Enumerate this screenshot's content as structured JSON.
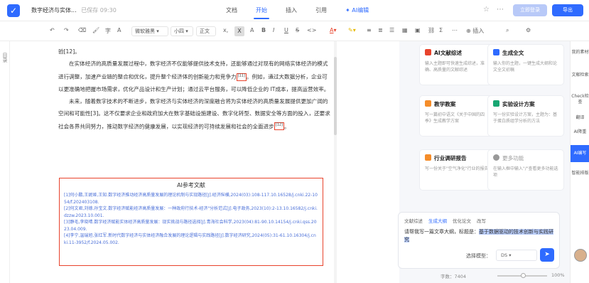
{
  "app": {
    "doc_title": "数字经济与实体...",
    "saved_status": "已保存 09:30"
  },
  "tabs": [
    {
      "label": "文档"
    },
    {
      "label": "开始"
    },
    {
      "label": "插入"
    },
    {
      "label": "引用"
    },
    {
      "label": "AI编辑"
    }
  ],
  "header_buttons": {
    "login": "立即登录",
    "export": "导出"
  },
  "toolbar": {
    "font_family": "微软雅黑",
    "font_size": "小四",
    "paragraph_style": "正文",
    "insert": "插入"
  },
  "gutter": {
    "label": "目录"
  },
  "document": {
    "p0": "验[12]。",
    "p1_a": "在实体经济的高质量发展过程中，数字经济不仅能够提供技术支持，还能够通过对现有的网络实体经济的模式进行调整，加速产业链的整合和优化，提升整个经济体的创新能力和竞争力",
    "p1_cite": "[11]",
    "p1_b": "。例如，通过大数据分析，企业可以更准确地把握市场需求，优化产品设计和生产计划；通过云平台服务，可以降低企业的 IT成本，提高运营效率。",
    "p2_a": "未来，随着数字技术的不断进步，数字经济与实体经济的深度融合将为实体经济的高质量发展提供更加广阔的空间和可能性[3]。这不仅要求企业和政府加大在数字基础设施建设、数字化转型、数据安全等方面的投入，还要求社会各界共同努力，推动数字经济的健康发展，以实现经济的可持续发展和社会的全面进步",
    "p2_cite": "[12]",
    "p2_b": "。"
  },
  "references": {
    "title": "AI参考文献",
    "items": [
      "[1]何小鹏,王妮娅,王知.数字经济推动经济高质量发展的理论机制与实现路径[J].经济纵横,2024(03):108-117.10.16528/j.cnki.22-1054/f.202403108.",
      "[2]何文君,刘德,孙宝文.数字经济赋能经济高质量发展：一种政府行技术-经济\"分析范式[J].电子政务,2023(10):2-13.10.16582/j.cnki.dzzw.2023.10.001.",
      "[3]静毛,李晓晴.数字经济赋能实体经济高质量发展：现实挑战与路径选择[J].青海社会科学,2023(04):81-90.10.14154/j.cnki.qss.2023.04.009.",
      "[4]李宁,温瑞旭,张红军.新时代数字经济与实体经济融合发展的理论逻辑与实践路径[J].数字经济研究,2024(05):31-61.10.16304/j.cnki.11-3952/f.2024.05.002."
    ]
  },
  "ai_panel": {
    "cards": [
      {
        "title": "AI文献综述",
        "desc": "输入主题即可快速生成综述，准确、高质量的文献综述",
        "color": "#e8432c"
      },
      {
        "title": "生成全文",
        "desc": "输入你的主题，一键生成大纲和论文全文初稿",
        "color": "#2f6bff"
      },
      {
        "title": "教学教案",
        "desc": "写一篇初中语文《关于中国的四季》生成教学方案",
        "color": "#f58d2a"
      },
      {
        "title": "实验设计方案",
        "desc": "写一份实验设计方案，主题为：基于蛋白质组学分析的方法",
        "color": "#19a773"
      },
      {
        "title": "行业调研报告",
        "desc": "写一份关于\"空气净化\"行业的报告",
        "color": "#f58d2a"
      },
      {
        "title": "更多功能",
        "desc": "在输入框中输入\"/\"查看更多功能选项",
        "color": "#999999"
      }
    ],
    "modes": [
      "文献综述",
      "生成大纲",
      "优化论文",
      "改写"
    ],
    "active_mode": 1,
    "prompt_prefix": "请帮我写一篇文章大纲，标题是：",
    "prompt_highlight": "基于数据驱动的技术创新与实践研究",
    "model_label": "选择模型：",
    "model_value": "DS"
  },
  "right_sidebar": {
    "items": [
      "我的素材",
      "文献检索",
      "Check检查",
      "翻译",
      "AI降重",
      "AI编写",
      "智能排版"
    ],
    "active": 5
  },
  "status": {
    "pages": "字数：7404",
    "zoom": "100%"
  }
}
